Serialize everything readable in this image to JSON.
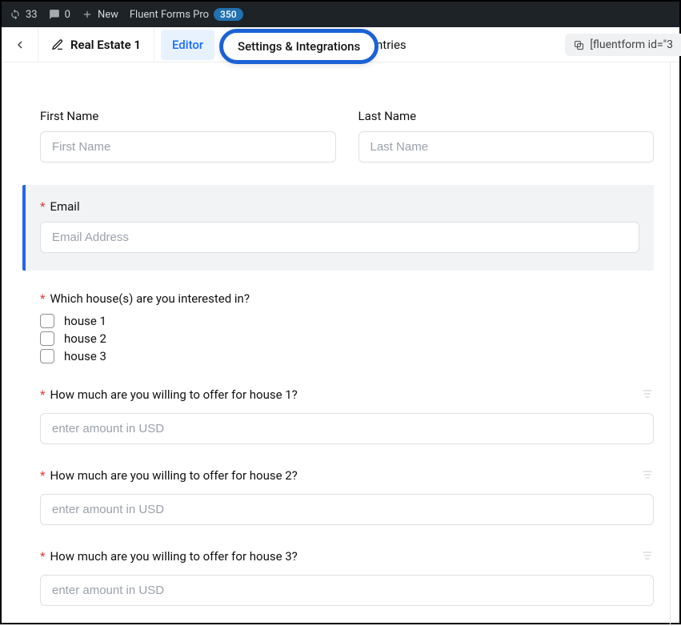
{
  "adminbar": {
    "updates_count": "33",
    "comments_count": "0",
    "new_label": "New",
    "product_name": "Fluent Forms Pro",
    "product_badge": "350"
  },
  "topbar": {
    "form_title": "Real Estate 1",
    "tabs": {
      "editor": "Editor",
      "settings": "Settings & Integrations",
      "entries": "Entries"
    },
    "shortcode_text": "[fluentform id=\"3"
  },
  "fields": {
    "first_name": {
      "label": "First Name",
      "placeholder": "First Name"
    },
    "last_name": {
      "label": "Last Name",
      "placeholder": "Last Name"
    },
    "email": {
      "label": "Email",
      "placeholder": "Email Address"
    },
    "houses_question": "Which house(s) are you interested in?",
    "houses_options": [
      "house 1",
      "house 2",
      "house 3"
    ],
    "offer1": {
      "label": "How much are you willing to offer for house 1?",
      "placeholder": "enter amount in USD"
    },
    "offer2": {
      "label": "How much are you willing to offer for house 2?",
      "placeholder": "enter amount in USD"
    },
    "offer3": {
      "label": "How much are you willing to offer for house 3?",
      "placeholder": "enter amount in USD"
    }
  }
}
